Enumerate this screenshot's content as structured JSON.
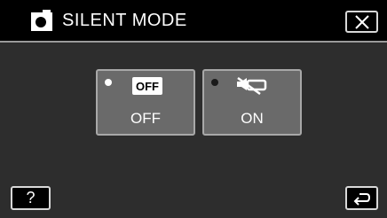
{
  "header": {
    "title": "SILENT MODE",
    "title_icon": "camera-icon",
    "close_icon": "close-icon"
  },
  "options": [
    {
      "label": "OFF",
      "icon_text": "OFF",
      "icon": "off-icon",
      "selected": true
    },
    {
      "label": "ON",
      "icon": "silent-mode-icon",
      "selected": false
    }
  ],
  "footer": {
    "help_label": "?",
    "back_icon": "return-icon"
  },
  "colors": {
    "header_bg": "#000000",
    "screen_bg": "#2d2d2d",
    "option_bg": "#6a6a6a",
    "border": "#d8d8d8"
  }
}
